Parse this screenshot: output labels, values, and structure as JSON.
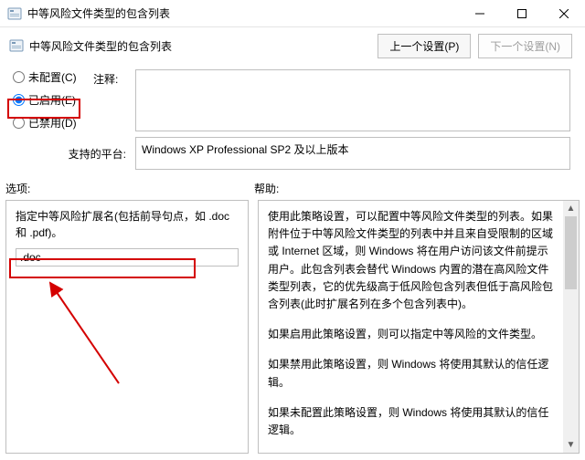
{
  "window": {
    "title": "中等风险文件类型的包含列表"
  },
  "header": {
    "subtitle": "中等风险文件类型的包含列表",
    "prev_btn": "上一个设置(P)",
    "next_btn": "下一个设置(N)"
  },
  "config": {
    "radio_not_configured": "未配置(C)",
    "radio_enabled": "已启用(E)",
    "radio_disabled": "已禁用(D)",
    "selected": "enabled",
    "comment_label": "注释:",
    "comment_value": "",
    "platform_label": "支持的平台:",
    "platform_value": "Windows XP Professional SP2 及以上版本"
  },
  "labels": {
    "options": "选项:",
    "help": "帮助:"
  },
  "options": {
    "description": "指定中等风险扩展名(包括前导句点，如 .doc 和 .pdf)。",
    "input_value": ".doc"
  },
  "help": {
    "p1": "使用此策略设置，可以配置中等风险文件类型的列表。如果附件位于中等风险文件类型的列表中并且来自受限制的区域或 Internet 区域，则 Windows 将在用户访问该文件前提示用户。此包含列表会替代 Windows 内置的潜在高风险文件类型列表，它的优先级高于低风险包含列表但低于高风险包含列表(此时扩展名列在多个包含列表中)。",
    "p2": "如果启用此策略设置，则可以指定中等风险的文件类型。",
    "p3": "如果禁用此策略设置，则 Windows 将使用其默认的信任逻辑。",
    "p4": "如果未配置此策略设置，则 Windows 将使用其默认的信任逻辑。"
  }
}
